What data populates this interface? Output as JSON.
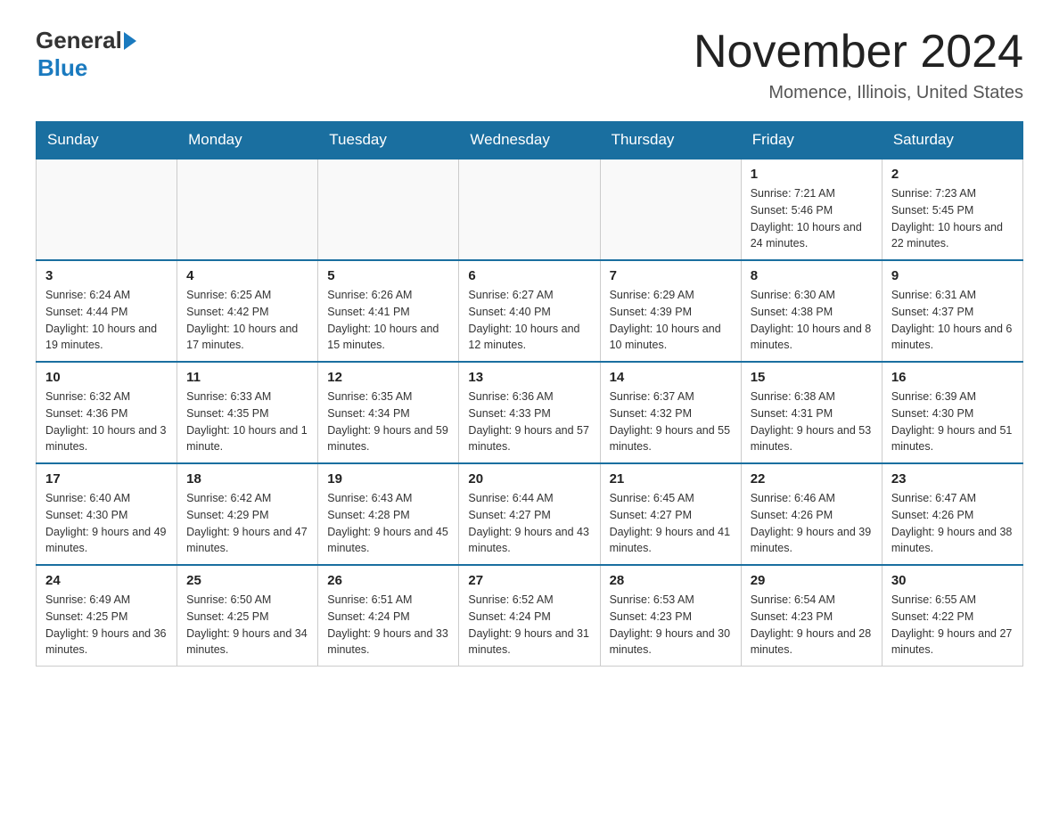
{
  "header": {
    "logo_general": "General",
    "logo_blue": "Blue",
    "month_title": "November 2024",
    "location": "Momence, Illinois, United States"
  },
  "days_of_week": [
    "Sunday",
    "Monday",
    "Tuesday",
    "Wednesday",
    "Thursday",
    "Friday",
    "Saturday"
  ],
  "weeks": [
    [
      {
        "day": "",
        "info": ""
      },
      {
        "day": "",
        "info": ""
      },
      {
        "day": "",
        "info": ""
      },
      {
        "day": "",
        "info": ""
      },
      {
        "day": "",
        "info": ""
      },
      {
        "day": "1",
        "info": "Sunrise: 7:21 AM\nSunset: 5:46 PM\nDaylight: 10 hours and 24 minutes."
      },
      {
        "day": "2",
        "info": "Sunrise: 7:23 AM\nSunset: 5:45 PM\nDaylight: 10 hours and 22 minutes."
      }
    ],
    [
      {
        "day": "3",
        "info": "Sunrise: 6:24 AM\nSunset: 4:44 PM\nDaylight: 10 hours and 19 minutes."
      },
      {
        "day": "4",
        "info": "Sunrise: 6:25 AM\nSunset: 4:42 PM\nDaylight: 10 hours and 17 minutes."
      },
      {
        "day": "5",
        "info": "Sunrise: 6:26 AM\nSunset: 4:41 PM\nDaylight: 10 hours and 15 minutes."
      },
      {
        "day": "6",
        "info": "Sunrise: 6:27 AM\nSunset: 4:40 PM\nDaylight: 10 hours and 12 minutes."
      },
      {
        "day": "7",
        "info": "Sunrise: 6:29 AM\nSunset: 4:39 PM\nDaylight: 10 hours and 10 minutes."
      },
      {
        "day": "8",
        "info": "Sunrise: 6:30 AM\nSunset: 4:38 PM\nDaylight: 10 hours and 8 minutes."
      },
      {
        "day": "9",
        "info": "Sunrise: 6:31 AM\nSunset: 4:37 PM\nDaylight: 10 hours and 6 minutes."
      }
    ],
    [
      {
        "day": "10",
        "info": "Sunrise: 6:32 AM\nSunset: 4:36 PM\nDaylight: 10 hours and 3 minutes."
      },
      {
        "day": "11",
        "info": "Sunrise: 6:33 AM\nSunset: 4:35 PM\nDaylight: 10 hours and 1 minute."
      },
      {
        "day": "12",
        "info": "Sunrise: 6:35 AM\nSunset: 4:34 PM\nDaylight: 9 hours and 59 minutes."
      },
      {
        "day": "13",
        "info": "Sunrise: 6:36 AM\nSunset: 4:33 PM\nDaylight: 9 hours and 57 minutes."
      },
      {
        "day": "14",
        "info": "Sunrise: 6:37 AM\nSunset: 4:32 PM\nDaylight: 9 hours and 55 minutes."
      },
      {
        "day": "15",
        "info": "Sunrise: 6:38 AM\nSunset: 4:31 PM\nDaylight: 9 hours and 53 minutes."
      },
      {
        "day": "16",
        "info": "Sunrise: 6:39 AM\nSunset: 4:30 PM\nDaylight: 9 hours and 51 minutes."
      }
    ],
    [
      {
        "day": "17",
        "info": "Sunrise: 6:40 AM\nSunset: 4:30 PM\nDaylight: 9 hours and 49 minutes."
      },
      {
        "day": "18",
        "info": "Sunrise: 6:42 AM\nSunset: 4:29 PM\nDaylight: 9 hours and 47 minutes."
      },
      {
        "day": "19",
        "info": "Sunrise: 6:43 AM\nSunset: 4:28 PM\nDaylight: 9 hours and 45 minutes."
      },
      {
        "day": "20",
        "info": "Sunrise: 6:44 AM\nSunset: 4:27 PM\nDaylight: 9 hours and 43 minutes."
      },
      {
        "day": "21",
        "info": "Sunrise: 6:45 AM\nSunset: 4:27 PM\nDaylight: 9 hours and 41 minutes."
      },
      {
        "day": "22",
        "info": "Sunrise: 6:46 AM\nSunset: 4:26 PM\nDaylight: 9 hours and 39 minutes."
      },
      {
        "day": "23",
        "info": "Sunrise: 6:47 AM\nSunset: 4:26 PM\nDaylight: 9 hours and 38 minutes."
      }
    ],
    [
      {
        "day": "24",
        "info": "Sunrise: 6:49 AM\nSunset: 4:25 PM\nDaylight: 9 hours and 36 minutes."
      },
      {
        "day": "25",
        "info": "Sunrise: 6:50 AM\nSunset: 4:25 PM\nDaylight: 9 hours and 34 minutes."
      },
      {
        "day": "26",
        "info": "Sunrise: 6:51 AM\nSunset: 4:24 PM\nDaylight: 9 hours and 33 minutes."
      },
      {
        "day": "27",
        "info": "Sunrise: 6:52 AM\nSunset: 4:24 PM\nDaylight: 9 hours and 31 minutes."
      },
      {
        "day": "28",
        "info": "Sunrise: 6:53 AM\nSunset: 4:23 PM\nDaylight: 9 hours and 30 minutes."
      },
      {
        "day": "29",
        "info": "Sunrise: 6:54 AM\nSunset: 4:23 PM\nDaylight: 9 hours and 28 minutes."
      },
      {
        "day": "30",
        "info": "Sunrise: 6:55 AM\nSunset: 4:22 PM\nDaylight: 9 hours and 27 minutes."
      }
    ]
  ]
}
